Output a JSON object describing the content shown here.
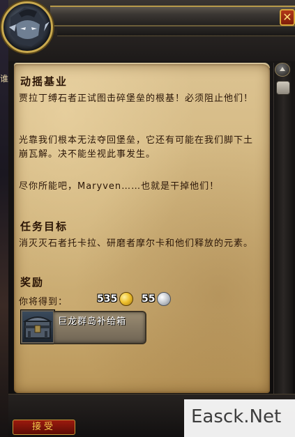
{
  "quest": {
    "title": "动摇基业",
    "paragraphs": [
      "贾拉丁缚石者正试图击碎堡垒的根基！必须阻止他们！",
      "光靠我们根本无法夺回堡垒，它还有可能在我们脚下土崩瓦解。决不能坐视此事发生。",
      "尽你所能吧，Maryven……也就是干掉他们！"
    ],
    "objectives_heading": "任务目标",
    "objectives_text": "消灭灭石者托卡拉、研磨者摩尔卡和他们释放的元素。",
    "rewards_heading": "奖励",
    "rewards_receive_label": "你将得到：",
    "gold": "535",
    "silver": "55",
    "item_name": "巨龙群岛补给箱"
  },
  "buttons": {
    "accept": "接受",
    "close": "✕"
  },
  "watermark": "Easck.Net",
  "edge_text": "谁",
  "colors": {
    "parchment": "#d2b67f",
    "ink": "#2b1607",
    "frame_gold": "#c9a94e",
    "accept_red": "#9c1a0e"
  }
}
